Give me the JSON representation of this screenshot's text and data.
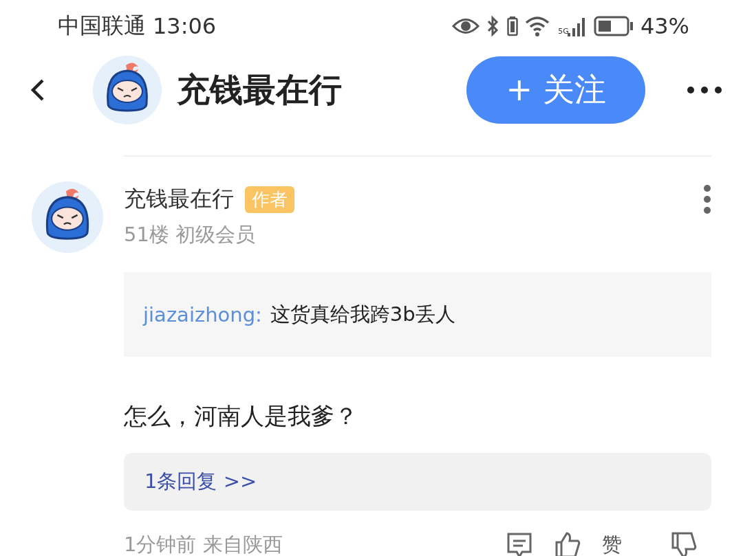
{
  "status_bar": {
    "carrier": "中国联通",
    "time": "13:06",
    "network": "5G",
    "battery": "43%"
  },
  "header": {
    "title": "充钱最在行",
    "follow_button": "+ 关注"
  },
  "comment": {
    "author": "充钱最在行",
    "badge": "作者",
    "floor_info": "51楼 初级会员",
    "quote": {
      "user": "jiazaizhong:",
      "text": "这货真给我跨3b丢人"
    },
    "body": "怎么，河南人是我爹？",
    "replies_link": "1条回复 >>",
    "meta": "1分钟前 来自陕西",
    "like_label": "赞"
  }
}
